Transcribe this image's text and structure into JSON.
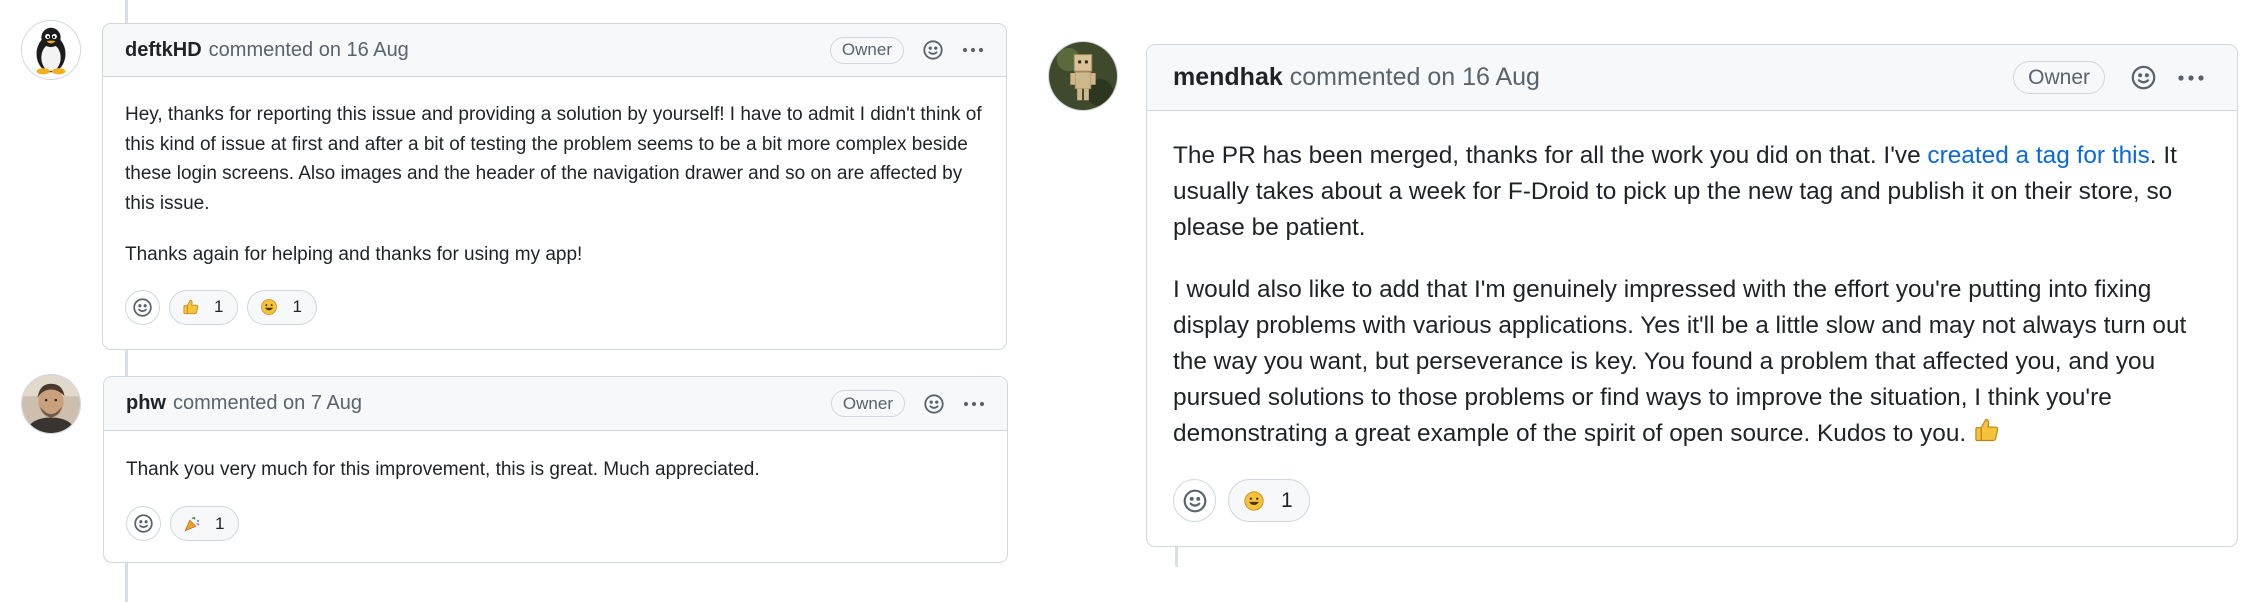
{
  "comments": [
    {
      "author": "deftkHD",
      "commented": "commented on 16 Aug",
      "badge": "Owner",
      "avatar": "tux-penguin-avatar",
      "paragraphs": [
        "Hey, thanks for reporting this issue and providing a solution by yourself! I have to admit I didn't think of this kind of issue at first and after a bit of testing the problem seems to be a bit more complex beside these login screens. Also images and the header of the navigation drawer and so on are affected by this issue.",
        "Thanks again for helping and thanks for using my app!"
      ],
      "reactions": [
        {
          "emoji": "thumbs-up",
          "count": "1"
        },
        {
          "emoji": "grinning-face",
          "count": "1"
        }
      ]
    },
    {
      "author": "phw",
      "commented": "commented on 7 Aug",
      "badge": "Owner",
      "avatar": "person-photo-avatar",
      "paragraphs": [
        "Thank you very much for this improvement, this is great. Much appreciated."
      ],
      "reactions": [
        {
          "emoji": "party-popper",
          "count": "1"
        }
      ]
    },
    {
      "author": "mendhak",
      "commented": "commented on 16 Aug",
      "badge": "Owner",
      "avatar": "cardboard-robot-avatar",
      "paragraph1": {
        "before": "The PR has been merged, thanks for all the work you did on that. I've ",
        "link": "created a tag for this",
        "after": ". It usually takes about a week for F-Droid to pick up the new tag and publish it on their store, so please be patient."
      },
      "paragraph2": "I would also like to add that I'm genuinely impressed with the effort you're putting into fixing display problems with various applications. Yes it'll be a little slow and may not always turn out the way you want, but perseverance is key. You found a problem that affected you, and you pursued solutions to those problems or find ways to improve the situation, I think you're demonstrating a great example of the spirit of open source. Kudos to you.",
      "paragraph2_emoji": "thumbs-up",
      "reactions": [
        {
          "emoji": "grinning-face",
          "count": "1"
        }
      ]
    }
  ],
  "colors": {
    "link": "#0969da",
    "border": "#d0d7de",
    "header_bg": "#f6f8fa",
    "muted_text": "#59636e"
  }
}
